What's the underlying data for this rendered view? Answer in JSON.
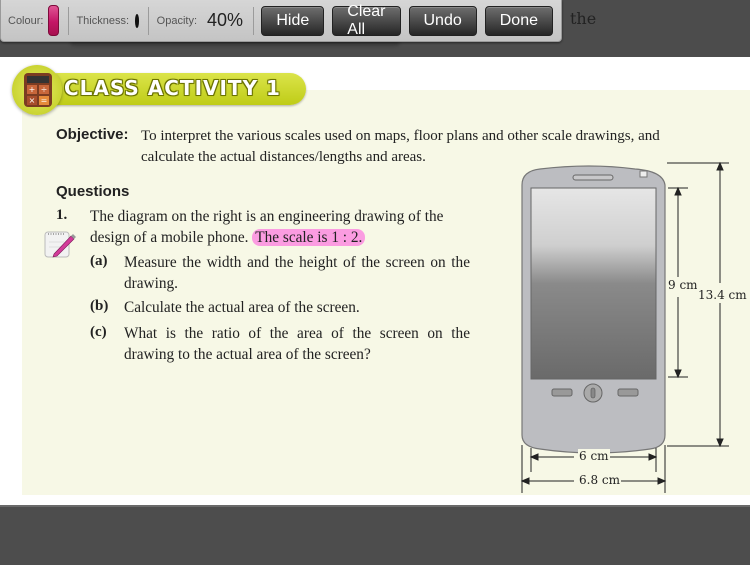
{
  "background_text": {
    "partial_word": "the"
  },
  "toolbar": {
    "colour_label": "Colour:",
    "colour_value": "#c41566",
    "thickness_label": "Thickness:",
    "opacity_label": "Opacity:",
    "opacity_value": "40%",
    "buttons": {
      "hide": "Hide",
      "clear_all": "Clear All",
      "undo": "Undo",
      "done": "Done"
    }
  },
  "activity": {
    "banner_title": "CLASS ACTIVITY 1",
    "calculator_keys": [
      "+",
      "÷",
      "×",
      "="
    ],
    "objective_label": "Objective:",
    "objective_text": "To interpret the various scales used on maps, floor plans and other scale drawings, and calculate the actual distances/lengths and areas.",
    "questions_heading": "Questions",
    "question1": {
      "number": "1.",
      "text": "The diagram on the right is an engineering drawing of the design of a mobile phone.",
      "highlighted_text": "The scale is 1 : 2.",
      "highlight_color": "#ff50dc",
      "parts": [
        {
          "label": "(a)",
          "text": "Measure the width and the height of the screen on the drawing."
        },
        {
          "label": "(b)",
          "text": "Calculate the actual area of the screen."
        },
        {
          "label": "(c)",
          "text": "What is the ratio of the area of the screen on the drawing to the actual area of the screen?"
        }
      ]
    },
    "diagram": {
      "screen_height": "9 cm",
      "phone_height": "13.4 cm",
      "screen_width": "6 cm",
      "phone_width": "6.8 cm"
    }
  }
}
